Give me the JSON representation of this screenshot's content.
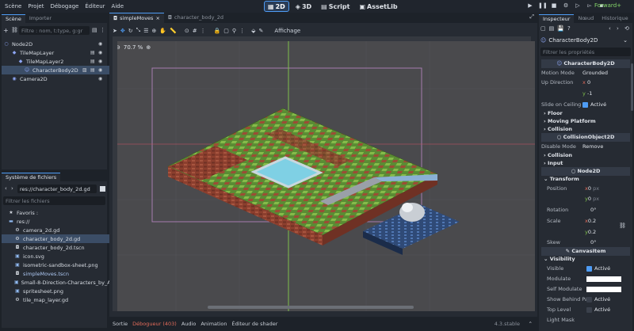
{
  "menubar": {
    "items": [
      "Scène",
      "Projet",
      "Débogage",
      "Éditeur",
      "Aide"
    ]
  },
  "workspaces": [
    {
      "label": "2D",
      "icon": "2d-icon",
      "active": true
    },
    {
      "label": "3D",
      "icon": "3d-icon",
      "active": false
    },
    {
      "label": "Script",
      "icon": "script-icon",
      "active": false
    },
    {
      "label": "AssetLib",
      "icon": "assetlib-icon",
      "active": false
    }
  ],
  "renderer": "Forward+",
  "scene_dock": {
    "tabs": [
      "Scène",
      "Importer"
    ],
    "filter_placeholder": "Filtre : nom, t:type, g:gr",
    "nodes": [
      {
        "label": "Node2D",
        "icon": "node2d-icon"
      },
      {
        "label": "TileMapLayer",
        "icon": "tilemaplayer-icon"
      },
      {
        "label": "TileMapLayer2",
        "icon": "tilemaplayer-icon"
      },
      {
        "label": "CharacterBody2D",
        "icon": "characterbody2d-icon",
        "selected": true
      },
      {
        "label": "Camera2D",
        "icon": "camera2d-icon"
      }
    ]
  },
  "filesystem": {
    "tab": "Système de fichiers",
    "path": "res://character_body_2d.gd",
    "filter_placeholder": "Filtrer les fichiers",
    "favorites": "Favoris :",
    "root": "res://",
    "files": [
      {
        "name": "camera_2d.gd",
        "icon": "gear-icon"
      },
      {
        "name": "character_body_2d.gd",
        "icon": "gear-icon",
        "selected": true
      },
      {
        "name": "character_body_2d.tscn",
        "icon": "scene-icon"
      },
      {
        "name": "icon.svg",
        "icon": "image-icon"
      },
      {
        "name": "isometric-sandbox-sheet.png",
        "icon": "image-icon"
      },
      {
        "name": "simpleMoves.tscn",
        "icon": "scene-icon"
      },
      {
        "name": "Small-8-Direction-Characters_by_Ax...",
        "icon": "image-icon"
      },
      {
        "name": "spritesheet.png",
        "icon": "image-icon"
      },
      {
        "name": "tile_map_layer.gd",
        "icon": "gear-icon"
      }
    ]
  },
  "editor_tabs": [
    {
      "label": "simpleMoves",
      "active": true
    },
    {
      "label": "character_body_2d",
      "active": false
    }
  ],
  "toolbar": {
    "view_label": "Affichage"
  },
  "viewport": {
    "zoom": "70.7 %"
  },
  "inspector": {
    "tabs": [
      "Inspecteur",
      "Nœud",
      "Historique"
    ],
    "node_label": "CharacterBody2D",
    "filter_placeholder": "Filtrer les propriétés",
    "class_header": "CharacterBody2D",
    "motion_mode_label": "Motion Mode",
    "motion_mode_value": "Grounded",
    "up_direction_label": "Up Direction",
    "up_x_label": "x",
    "up_x": "0",
    "up_y_label": "y",
    "up_y": "-1",
    "slide_ceiling_label": "Slide on Ceiling",
    "slide_ceiling_value": "Activé",
    "groups": [
      "Floor",
      "Moving Platform",
      "Collision"
    ],
    "collision_header": "CollisionObject2D",
    "disable_mode_label": "Disable Mode",
    "disable_mode_value": "Remove",
    "groups2": [
      "Collision",
      "Input"
    ],
    "node2d_header": "Node2D",
    "transform_label": "Transform",
    "position_label": "Position",
    "pos_x": "0",
    "pos_y": "0",
    "unit_px": "px",
    "rotation_label": "Rotation",
    "rotation_value": "0",
    "unit_deg": "°",
    "scale_label": "Scale",
    "scale_x": "0.2",
    "scale_y": "0.2",
    "skew_label": "Skew",
    "skew_value": "0",
    "canvasitem_header": "CanvasItem",
    "visibility_label": "Visibility",
    "visible_label": "Visible",
    "visible_value": "Activé",
    "modulate_label": "Modulate",
    "self_modulate_label": "Self Modulate",
    "show_behind_label": "Show Behind Pa",
    "show_behind_value": "Activé",
    "top_level_label": "Top Level",
    "top_level_value": "Activé",
    "light_mask_label": "Light Mask"
  },
  "bottom_panel": {
    "tabs": [
      "Sortie",
      "Débogueur (403)",
      "Audio",
      "Animation",
      "Éditeur de shader"
    ],
    "version": "4.3.stable"
  },
  "colors": {
    "accent": "#4e9cf5",
    "debug": "#e26b5a"
  }
}
